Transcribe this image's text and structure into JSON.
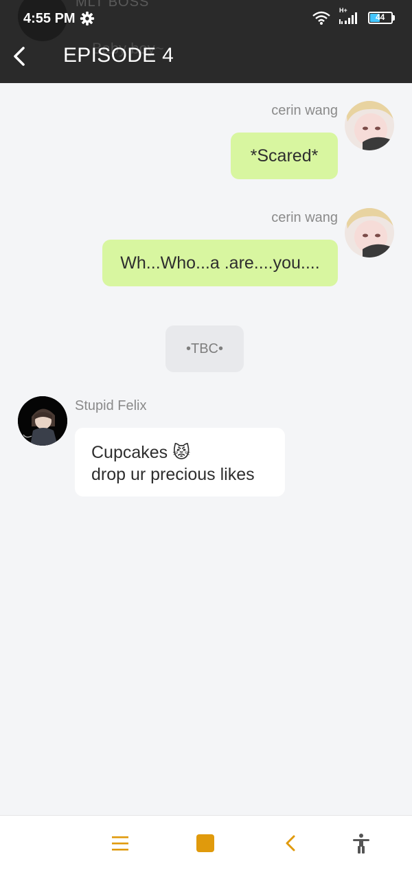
{
  "status_bar": {
    "time": "4:55 PM",
    "network": "H+",
    "battery": "44",
    "icons": [
      "gear-icon",
      "wifi-icon",
      "signal-icon",
      "battery-icon"
    ]
  },
  "background_text": {
    "line1": "MLT BOSS",
    "line2": "Baby boy~"
  },
  "header": {
    "title": "EPISODE 4",
    "back_icon": "chevron-left-icon"
  },
  "messages": [
    {
      "sender": "cerin wang",
      "text": "*Scared*"
    },
    {
      "sender": "cerin wang",
      "text": "Wh...Who...a .are....you...."
    },
    {
      "system": "•TBC•"
    },
    {
      "sender": "Stupid Felix",
      "line1": "Cupcakes 😾",
      "line2": "drop ur precious likes"
    }
  ],
  "nav": {
    "icons": [
      "menu-icon",
      "home-square-icon",
      "back-icon",
      "accessibility-icon"
    ]
  },
  "colors": {
    "header_bg": "#2a2a2a",
    "bubble_green": "#d8f6a0",
    "accent": "#e09a0c",
    "background": "#f4f5f7"
  }
}
